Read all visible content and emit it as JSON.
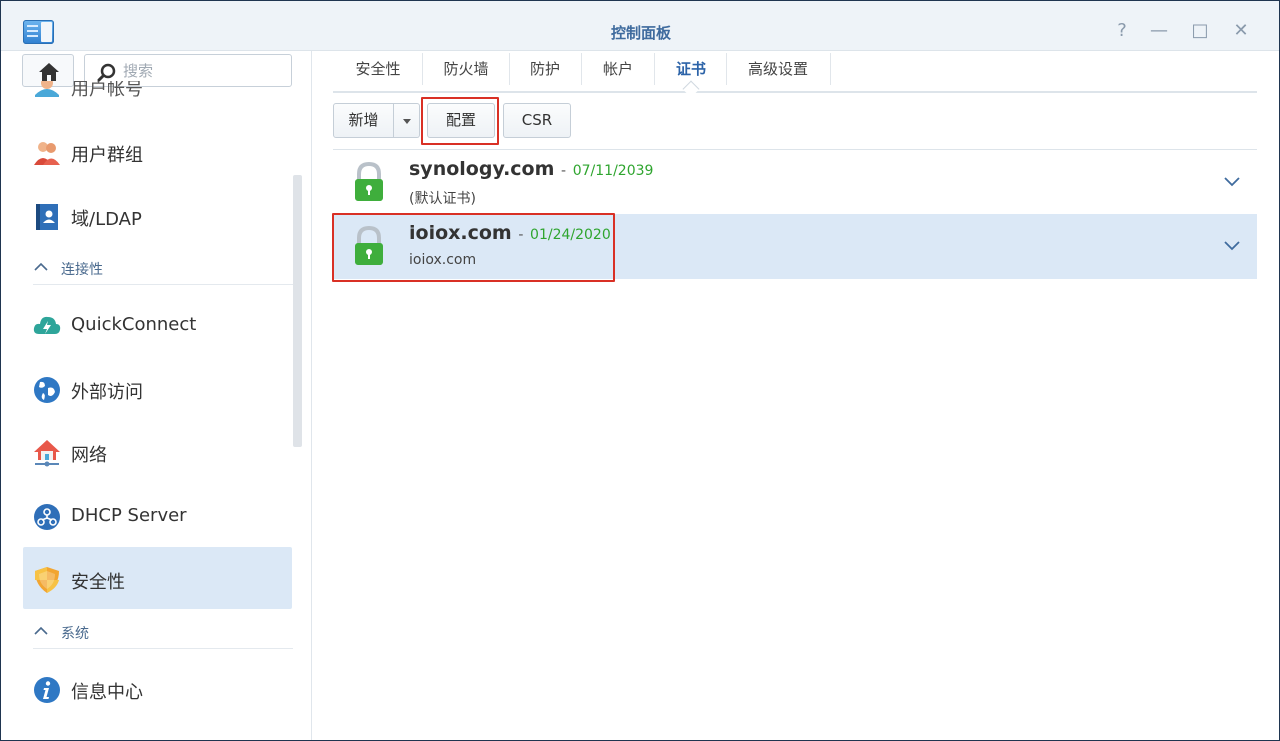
{
  "window": {
    "title": "控制面板",
    "controls": {
      "help": "?",
      "minimize": "—",
      "maximize": "□",
      "close": "✕"
    }
  },
  "sidebar": {
    "search_placeholder": "搜索",
    "items": [
      {
        "label": "用户帐号",
        "icon": "user-icon"
      },
      {
        "label": "用户群组",
        "icon": "group-icon"
      },
      {
        "label": "域/LDAP",
        "icon": "domain-icon"
      },
      {
        "label": "QuickConnect",
        "icon": "quickconnect-icon"
      },
      {
        "label": "外部访问",
        "icon": "globe-icon"
      },
      {
        "label": "网络",
        "icon": "network-icon"
      },
      {
        "label": "DHCP Server",
        "icon": "dhcp-icon"
      },
      {
        "label": "安全性",
        "icon": "shield-icon",
        "selected": true
      },
      {
        "label": "信息中心",
        "icon": "info-icon"
      }
    ],
    "sections": [
      {
        "label": "连接性"
      },
      {
        "label": "系统"
      }
    ]
  },
  "tabs": [
    {
      "label": "安全性"
    },
    {
      "label": "防火墙"
    },
    {
      "label": "防护"
    },
    {
      "label": "帐户"
    },
    {
      "label": "证书",
      "active": true
    },
    {
      "label": "高级设置"
    }
  ],
  "toolbar": {
    "add_label": "新增",
    "configure_label": "配置",
    "csr_label": "CSR"
  },
  "certificates": [
    {
      "domain": "synology.com",
      "separator": "-",
      "expiry": "07/11/2039",
      "subtitle": "(默认证书)"
    },
    {
      "domain": "ioiox.com",
      "separator": "-",
      "expiry": "01/24/2020",
      "subtitle": "ioiox.com",
      "selected": true
    }
  ],
  "colors": {
    "accent": "#2c63a8",
    "selected_bg": "#dbe8f6",
    "expiry_green": "#2fa52f",
    "highlight_red": "#d93025",
    "lock_green": "#3fae3c"
  }
}
